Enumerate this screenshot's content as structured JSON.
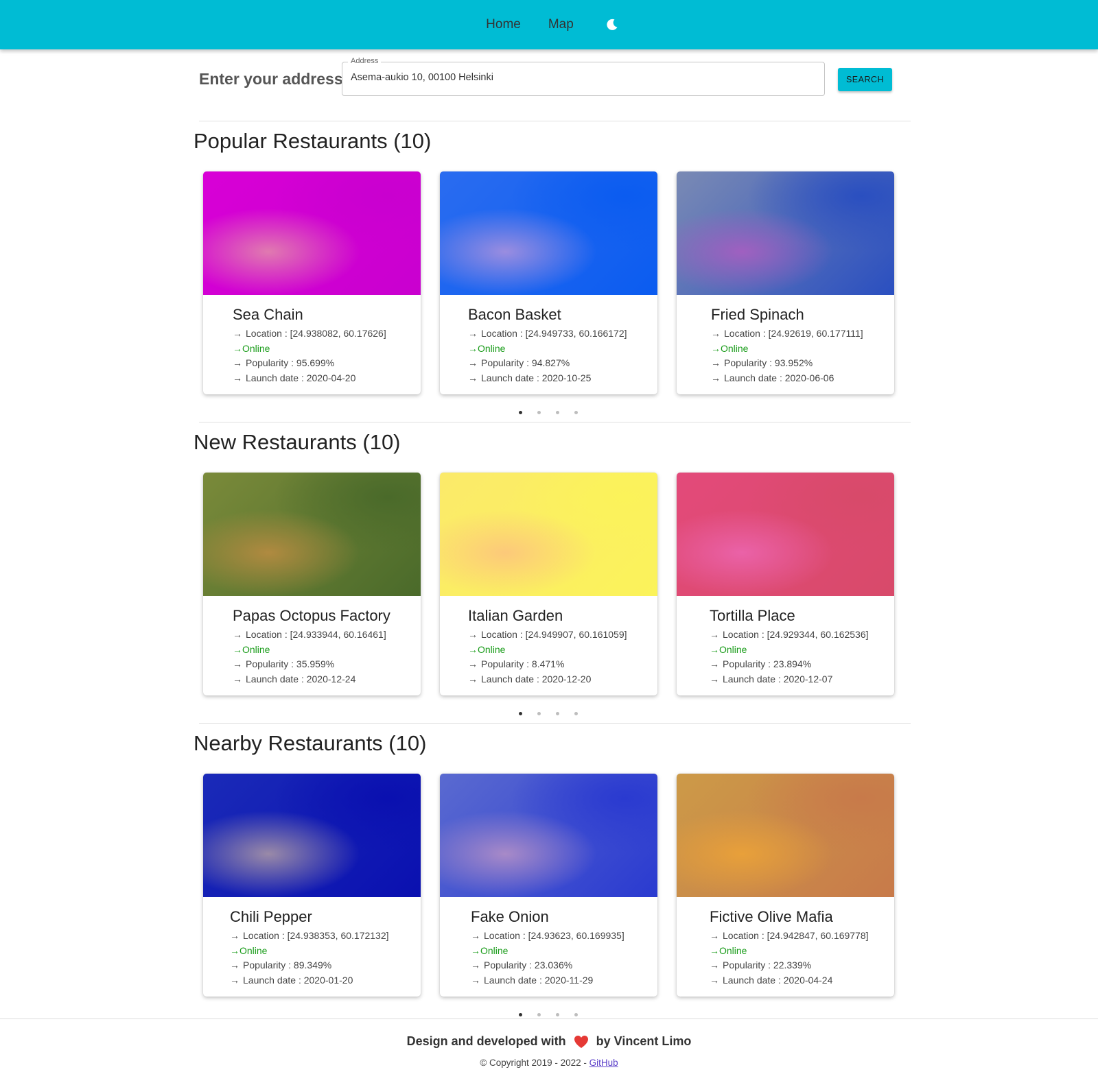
{
  "nav": {
    "home_label": "Home",
    "map_label": "Map",
    "theme_icon": "moon-icon"
  },
  "address": {
    "label": "Enter your address",
    "legend": "Address",
    "value": "Asema-aukio 10, 00100 Helsinki",
    "search_label": "SEARCH"
  },
  "sections": [
    {
      "title": "Popular Restaurants (10)",
      "restaurants": [
        {
          "name": "Sea Chain",
          "location": "Location : [24.938082, 60.17626]",
          "status": "Online",
          "popularity": "Popularity : 95.699%",
          "launch_date": "Launch date : 2020-04-20",
          "blurhash_colors": [
            "#d800d6",
            "#e07ab0",
            "#c900cf"
          ]
        },
        {
          "name": "Bacon Basket",
          "location": "Location : [24.949733, 60.166172]",
          "status": "Online",
          "popularity": "Popularity : 94.827%",
          "launch_date": "Launch date : 2020-10-25",
          "blurhash_colors": [
            "#2a6cf0",
            "#9a8de0",
            "#0b5cf0"
          ]
        },
        {
          "name": "Fried Spinach",
          "location": "Location : [24.92619, 60.177111]",
          "status": "Online",
          "popularity": "Popularity : 93.952%",
          "launch_date": "Launch date : 2020-06-06",
          "blurhash_colors": [
            "#7a8ab4",
            "#a060c0",
            "#2a4fc0"
          ]
        }
      ],
      "dots": 4,
      "active_dot": 0
    },
    {
      "title": "New Restaurants (10)",
      "restaurants": [
        {
          "name": "Papas Octopus Factory",
          "location": "Location : [24.933944, 60.16461]",
          "status": "Online",
          "popularity": "Popularity : 35.959%",
          "launch_date": "Launch date : 2020-12-24",
          "blurhash_colors": [
            "#7a8a3a",
            "#b08a40",
            "#4a6a2a"
          ]
        },
        {
          "name": "Italian Garden",
          "location": "Location : [24.949907, 60.161059]",
          "status": "Online",
          "popularity": "Popularity : 8.471%",
          "launch_date": "Launch date : 2020-12-20",
          "blurhash_colors": [
            "#fbea6a",
            "#fcc97a",
            "#fbf35a"
          ]
        },
        {
          "name": "Tortilla Place",
          "location": "Location : [24.929344, 60.162536]",
          "status": "Online",
          "popularity": "Popularity : 23.894%",
          "launch_date": "Launch date : 2020-12-07",
          "blurhash_colors": [
            "#e34a7a",
            "#ea62a8",
            "#d84a6a"
          ]
        }
      ],
      "dots": 4,
      "active_dot": 0
    },
    {
      "title": "Nearby Restaurants (10)",
      "restaurants": [
        {
          "name": "Chili Pepper",
          "location": "Location : [24.938353, 60.172132]",
          "status": "Online",
          "popularity": "Popularity : 89.349%",
          "launch_date": "Launch date : 2020-01-20",
          "blurhash_colors": [
            "#1a2ab8",
            "#9a8aa8",
            "#0a10b0"
          ]
        },
        {
          "name": "Fake Onion",
          "location": "Location : [24.93623, 60.169935]",
          "status": "Online",
          "popularity": "Popularity : 23.036%",
          "launch_date": "Launch date : 2020-11-29",
          "blurhash_colors": [
            "#5a6ad0",
            "#a88ac8",
            "#2a3ad0"
          ]
        },
        {
          "name": "Fictive Olive Mafia",
          "location": "Location : [24.942847, 60.169778]",
          "status": "Online",
          "popularity": "Popularity : 22.339%",
          "launch_date": "Launch date : 2020-04-24",
          "blurhash_colors": [
            "#cc9a48",
            "#e8a03a",
            "#c87a4a"
          ]
        }
      ],
      "dots": 4,
      "active_dot": 0
    }
  ],
  "footer": {
    "text_before": "Design and developed with",
    "text_after": "by Vincent Limo",
    "copyright": "© Copyright 2019 - 2022 -",
    "github_label": "GitHub"
  },
  "colors": {
    "primary": "#00bcd4",
    "online": "#1a9c1a",
    "heart": "#e53935"
  }
}
